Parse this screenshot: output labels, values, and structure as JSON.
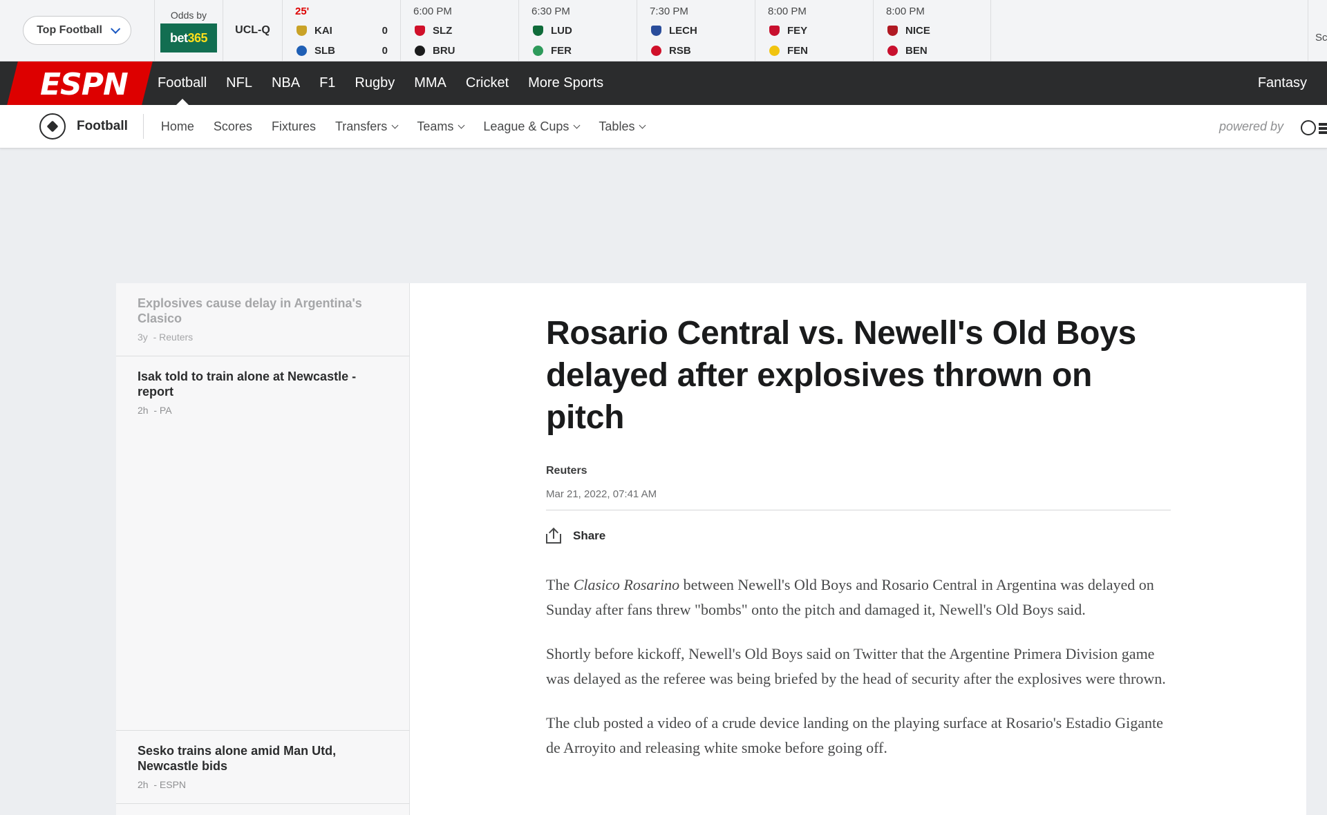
{
  "scores": {
    "league_selector": "Top Football",
    "odds_label": "Odds by",
    "odds_brand_a": "bet",
    "odds_brand_b": "365",
    "competition": "UCL-Q",
    "right_cut_text": "Sc",
    "matches": [
      {
        "time": "25'",
        "live": true,
        "teams": [
          {
            "abbr": "KAI",
            "score": "0",
            "color": "#c9a227"
          },
          {
            "abbr": "SLB",
            "score": "0",
            "color": "#1f5fb5"
          }
        ]
      },
      {
        "time": "6:00 PM",
        "teams": [
          {
            "abbr": "SLZ",
            "score": "",
            "color": "#d0102a"
          },
          {
            "abbr": "BRU",
            "score": "",
            "color": "#1b1c1d"
          }
        ]
      },
      {
        "time": "6:30 PM",
        "teams": [
          {
            "abbr": "LUD",
            "score": "",
            "color": "#0f6b3a"
          },
          {
            "abbr": "FER",
            "score": "",
            "color": "#2e9a5b"
          }
        ]
      },
      {
        "time": "7:30 PM",
        "teams": [
          {
            "abbr": "LECH",
            "score": "",
            "color": "#2a4d9b"
          },
          {
            "abbr": "RSB",
            "score": "",
            "color": "#d0102a"
          }
        ]
      },
      {
        "time": "8:00 PM",
        "teams": [
          {
            "abbr": "FEY",
            "score": "",
            "color": "#c8102e"
          },
          {
            "abbr": "FEN",
            "score": "",
            "color": "#f1c40f"
          }
        ]
      },
      {
        "time": "8:00 PM",
        "teams": [
          {
            "abbr": "NICE",
            "score": "",
            "color": "#b01923"
          },
          {
            "abbr": "BEN",
            "score": "",
            "color": "#c8102e"
          }
        ]
      }
    ]
  },
  "nav": {
    "logo": "ESPN",
    "items": [
      "Football",
      "NFL",
      "NBA",
      "F1",
      "Rugby",
      "MMA",
      "Cricket",
      "More Sports"
    ],
    "right": "Fantasy"
  },
  "subnav": {
    "sport": "Football",
    "items": [
      {
        "label": "Home",
        "dropdown": false
      },
      {
        "label": "Scores",
        "dropdown": false
      },
      {
        "label": "Fixtures",
        "dropdown": false
      },
      {
        "label": "Transfers",
        "dropdown": true
      },
      {
        "label": "Teams",
        "dropdown": true
      },
      {
        "label": "League & Cups",
        "dropdown": true
      },
      {
        "label": "Tables",
        "dropdown": true
      }
    ],
    "powered_by": "powered by"
  },
  "sidebar": {
    "items": [
      {
        "headline": "Explosives cause delay in Argentina's Clasico",
        "age": "3y",
        "source": "Reuters",
        "current": true
      },
      {
        "headline": "Isak told to train alone at Newcastle - report",
        "age": "2h",
        "source": "PA"
      },
      {
        "headline": "Sesko trains alone amid Man Utd, Newcastle bids",
        "age": "2h",
        "source": "ESPN"
      }
    ]
  },
  "article": {
    "title": "Rosario Central vs. Newell's Old Boys delayed after explosives thrown on pitch",
    "author": "Reuters",
    "date": "Mar 21, 2022, 07:41 AM",
    "share": "Share",
    "p1_pre": "The ",
    "p1_em": "Clasico Rosarino",
    "p1_post": " between Newell's Old Boys and Rosario Central in Argentina was delayed on Sunday after fans threw \"bombs\" onto the pitch and damaged it, Newell's Old Boys said.",
    "p2": "Shortly before kickoff, Newell's Old Boys said on Twitter that the Argentine Primera Division game was delayed as the referee was being briefed by the head of security after the explosives were thrown.",
    "p3": "The club posted a video of a crude device landing on the playing surface at Rosario's Estadio Gigante de Arroyito and releasing white smoke before going off."
  }
}
